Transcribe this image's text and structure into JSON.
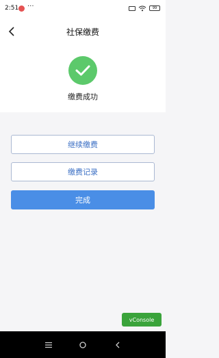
{
  "status_bar": {
    "time": "2:51",
    "more": "···",
    "battery": "99"
  },
  "nav": {
    "title": "社保缴费"
  },
  "result": {
    "message": "缴费成功"
  },
  "buttons": {
    "continue_label": "继续缴费",
    "records_label": "缴费记录",
    "done_label": "完成"
  },
  "vconsole": {
    "label": "vConsole"
  },
  "colors": {
    "success": "#5cc96b",
    "primary": "#4a8ee6",
    "outline_text": "#3b6fc4",
    "vconsole": "#3aa33b"
  }
}
